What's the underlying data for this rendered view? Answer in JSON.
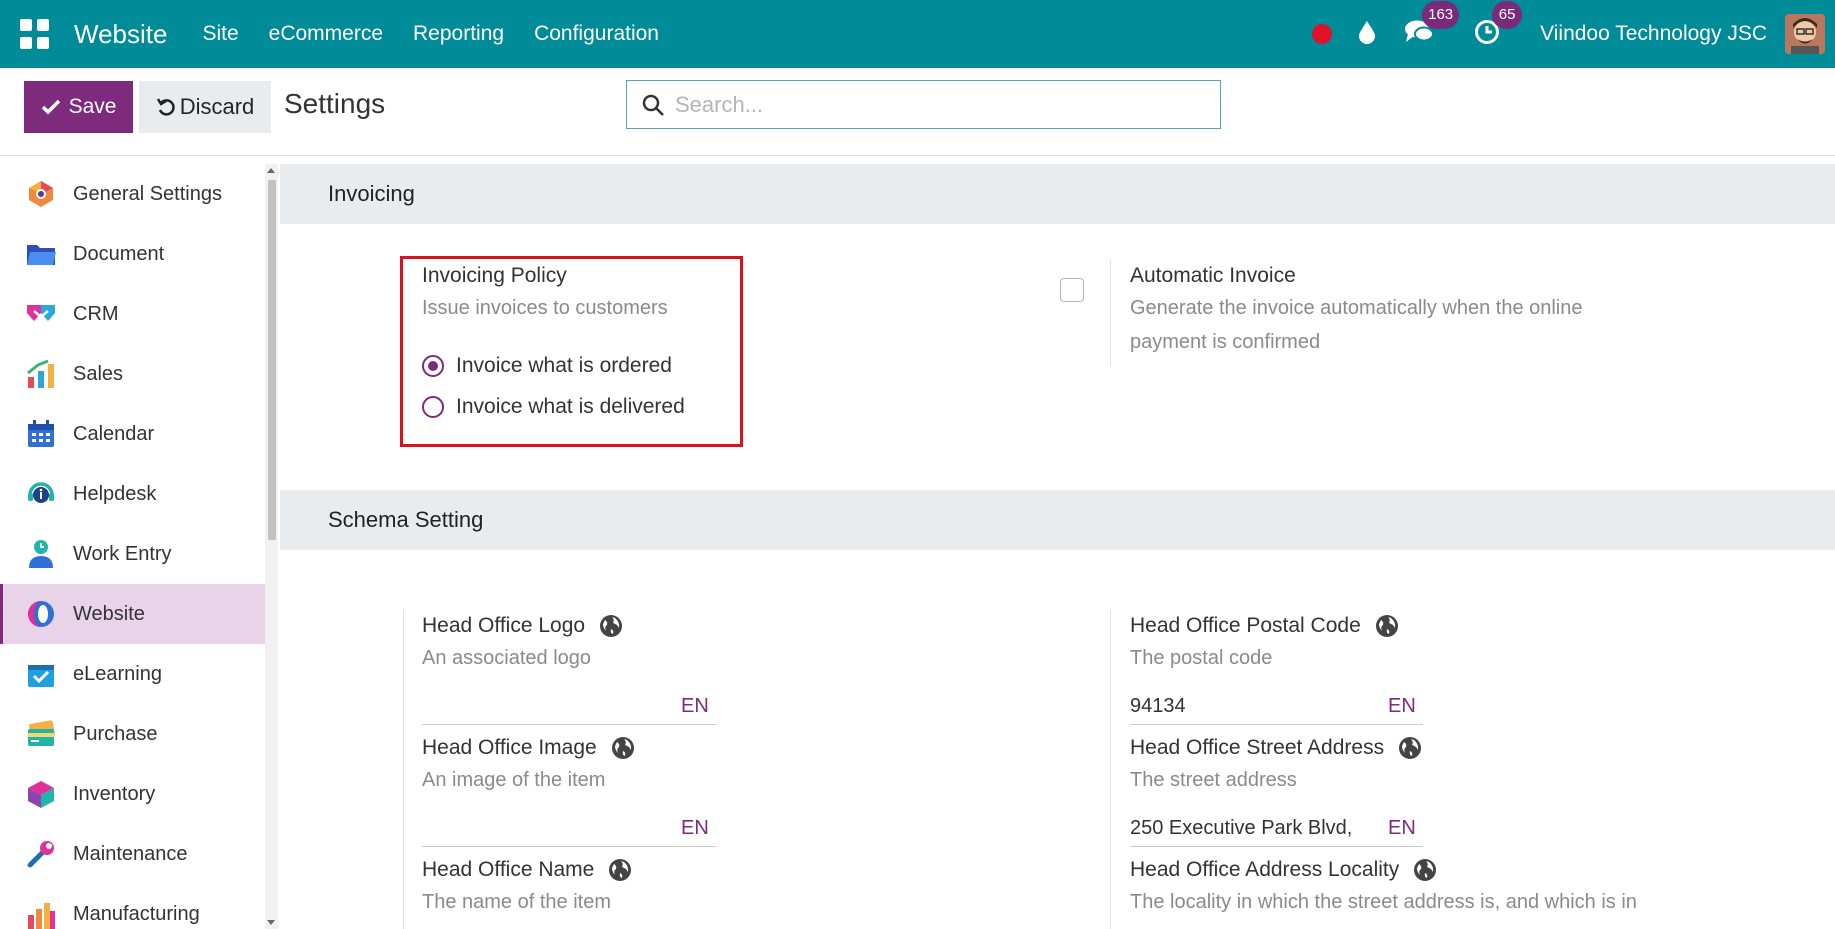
{
  "topbar": {
    "app_name": "Website",
    "menu": [
      "Site",
      "eCommerce",
      "Reporting",
      "Configuration"
    ],
    "chat_count": "163",
    "activity_count": "65",
    "company": "Viindoo Technology JSC",
    "accent": "#008b98"
  },
  "control": {
    "save_label": "Save",
    "discard_label": "Discard",
    "title": "Settings",
    "search_placeholder": "Search..."
  },
  "sidebar": {
    "items": [
      {
        "label": "General Settings",
        "icon": "general-settings-icon"
      },
      {
        "label": "Document",
        "icon": "folder-icon"
      },
      {
        "label": "CRM",
        "icon": "handshake-icon"
      },
      {
        "label": "Sales",
        "icon": "chart-icon"
      },
      {
        "label": "Calendar",
        "icon": "calendar-icon"
      },
      {
        "label": "Helpdesk",
        "icon": "headset-icon"
      },
      {
        "label": "Work Entry",
        "icon": "person-clock-icon"
      },
      {
        "label": "Website",
        "icon": "website-icon"
      },
      {
        "label": "eLearning",
        "icon": "elearning-icon"
      },
      {
        "label": "Purchase",
        "icon": "card-icon"
      },
      {
        "label": "Inventory",
        "icon": "cube-icon"
      },
      {
        "label": "Maintenance",
        "icon": "wrench-icon"
      },
      {
        "label": "Manufacturing",
        "icon": "factory-icon"
      }
    ],
    "active_index": 7
  },
  "invoicing": {
    "section_title": "Invoicing",
    "policy_title": "Invoicing Policy",
    "policy_desc": "Issue invoices to customers",
    "options": [
      "Invoice what is ordered",
      "Invoice what is delivered"
    ],
    "selected": 0,
    "auto_title": "Automatic Invoice",
    "auto_desc_1": "Generate the invoice automatically when the online",
    "auto_desc_2": "payment is confirmed"
  },
  "schema": {
    "section_title": "Schema Setting",
    "logo_title": "Head Office Logo",
    "logo_desc": "An associated logo",
    "image_title": "Head Office Image",
    "image_desc": "An image of the item",
    "name_title": "Head Office Name",
    "name_desc": "The name of the item",
    "postal_title": "Head Office Postal Code",
    "postal_desc": "The postal code",
    "postal_value": "94134",
    "street_title": "Head Office Street Address",
    "street_desc": "The street address",
    "street_value": "250 Executive Park Blvd,",
    "locality_title": "Head Office Address Locality",
    "locality_desc": "The locality in which the street address is, and which is in",
    "lang": "EN"
  }
}
